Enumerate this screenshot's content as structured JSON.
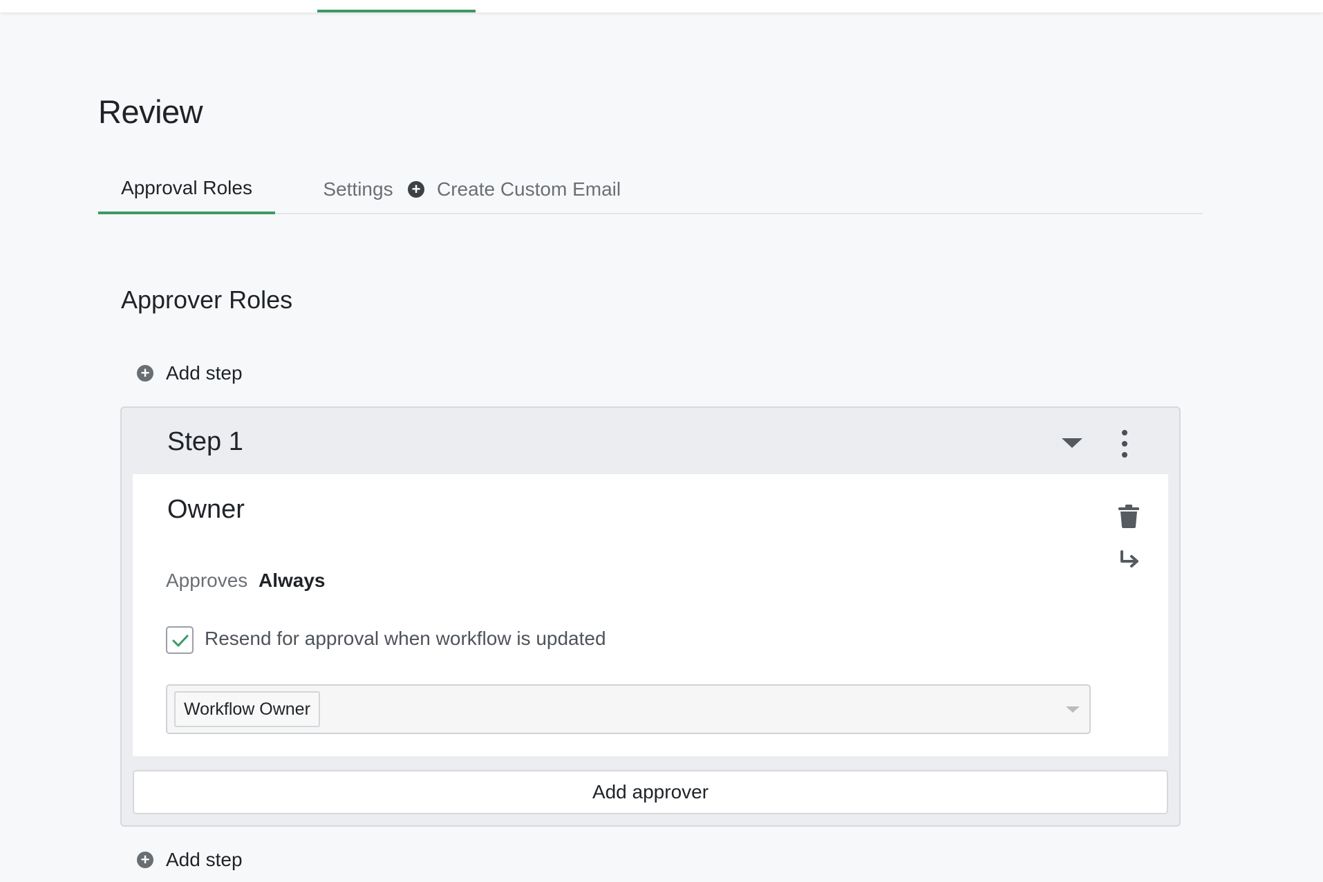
{
  "header": {
    "title": "Review"
  },
  "tabs": [
    {
      "label": "Approval Roles",
      "active": true
    },
    {
      "label": "Settings",
      "active": false
    },
    {
      "label": "Create Custom Email",
      "active": false,
      "icon": "plus-circle-icon"
    }
  ],
  "section": {
    "title": "Approver Roles",
    "add_step_label": "Add step"
  },
  "step": {
    "title": "Step 1",
    "approver": {
      "name": "Owner",
      "approves_label": "Approves",
      "approves_value": "Always",
      "resend_label": "Resend for approval when workflow is updated",
      "resend_checked": true,
      "selected_tag": "Workflow Owner"
    },
    "add_approver_label": "Add approver"
  },
  "colors": {
    "accent": "#3c9a66",
    "background": "#f7f8f9",
    "step_background": "#ecedf0"
  }
}
